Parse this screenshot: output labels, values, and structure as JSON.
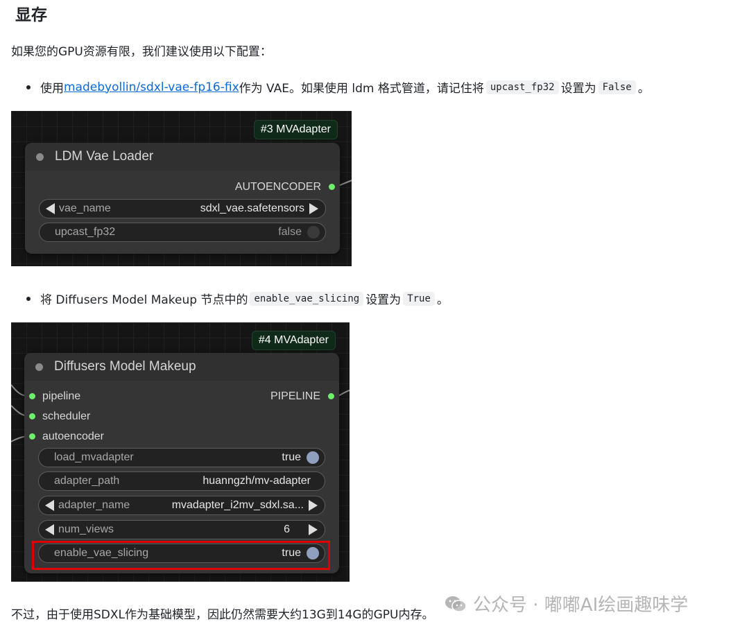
{
  "heading": "显存",
  "intro": "如果您的GPU资源有限，我们建议使用以下配置：",
  "bullet1": {
    "prefix": "使用",
    "link": "madebyollin/sdxl-vae-fp16-fix",
    "mid": "作为 VAE。如果使用 ldm 格式管道，请记住将",
    "code1": "upcast_fp32",
    "mid2": "设置为",
    "code2": "False",
    "suffix": "。"
  },
  "node1": {
    "badge": "#3 MVAdapter",
    "title": "LDM Vae Loader",
    "output": "AUTOENCODER",
    "widgets": [
      {
        "name": "vae_name",
        "value": "sdxl_vae.safetensors"
      },
      {
        "name": "upcast_fp32",
        "value": "false"
      }
    ]
  },
  "bullet2": {
    "prefix": "将 Diffusers Model Makeup 节点中的",
    "code1": "enable_vae_slicing",
    "mid": "设置为",
    "code2": "True",
    "suffix": "。"
  },
  "node2": {
    "badge": "#4 MVAdapter",
    "title": "Diffusers Model Makeup",
    "inputs": [
      "pipeline",
      "scheduler",
      "autoencoder"
    ],
    "output": "PIPELINE",
    "widgets": [
      {
        "name": "load_mvadapter",
        "value": "true"
      },
      {
        "name": "adapter_path",
        "value": "huanngzh/mv-adapter"
      },
      {
        "name": "adapter_name",
        "value": "mvadapter_i2mv_sdxl.sa..."
      },
      {
        "name": "num_views",
        "value": "6"
      },
      {
        "name": "enable_vae_slicing",
        "value": "true"
      }
    ]
  },
  "footer": "不过，由于使用SDXL作为基础模型，因此仍然需要大约13G到14G的GPU内存。",
  "watermark": "公众号 · 嘟嘟AI绘画趣味学",
  "colors": {
    "link": "#0969da",
    "highlight": "#e00000",
    "slot": "#6ef06e"
  }
}
